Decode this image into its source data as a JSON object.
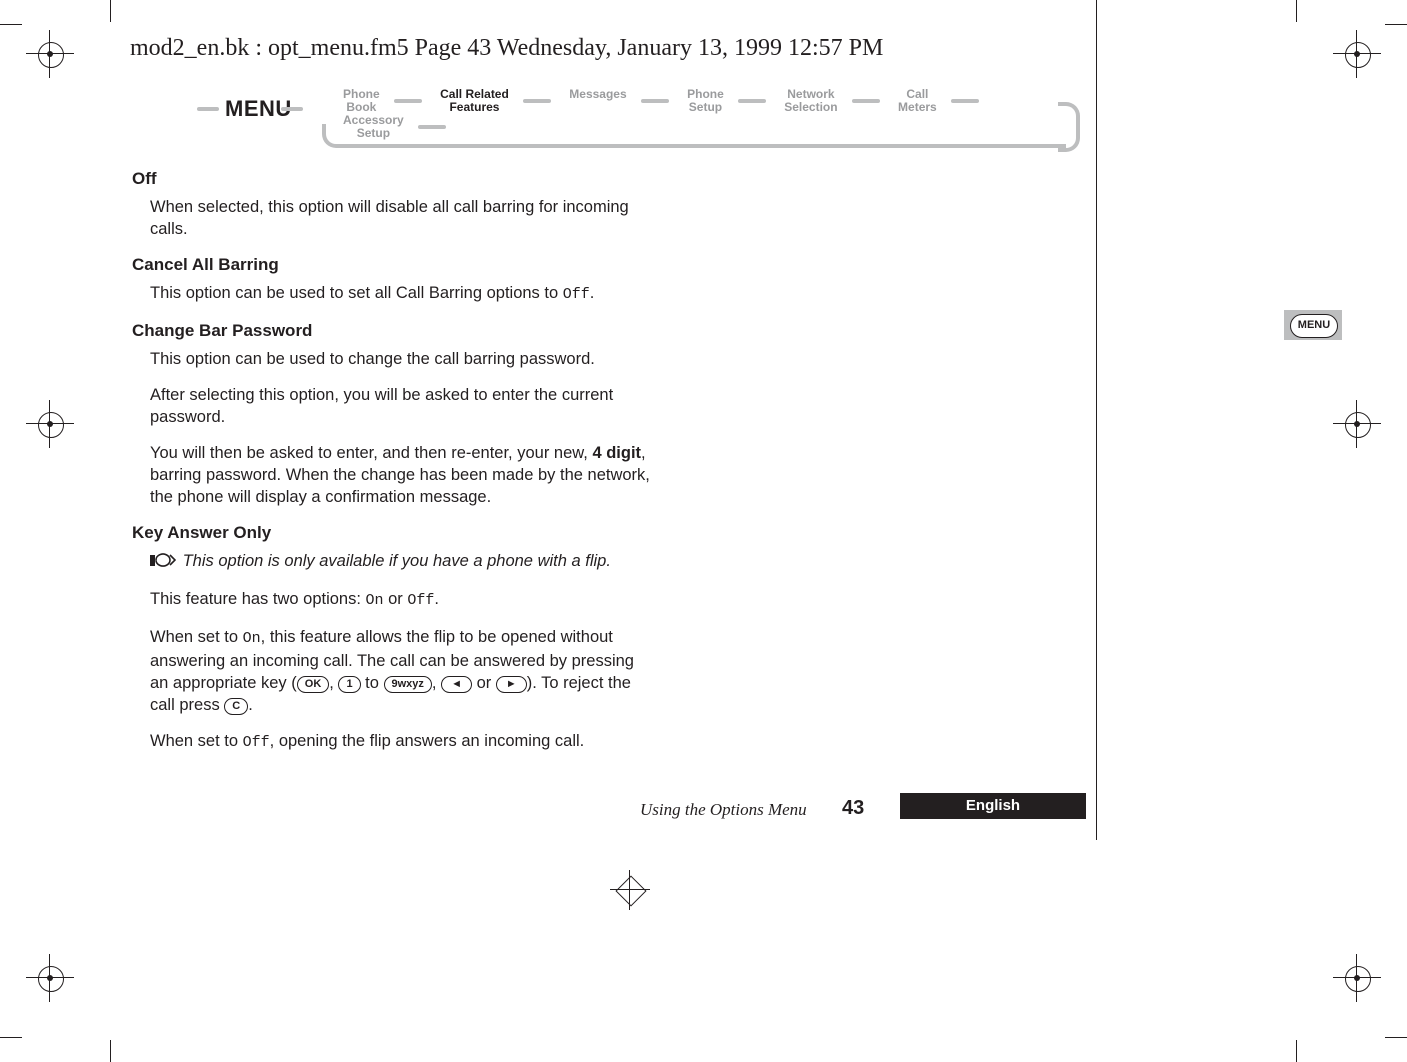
{
  "running_header": "mod2_en.bk : opt_menu.fm5  Page 43  Wednesday, January 13, 1999  12:57 PM",
  "menu": {
    "label": "MENU",
    "crumbs": [
      {
        "l1": "Phone",
        "l2": "Book",
        "active": false
      },
      {
        "l1": "Call Related",
        "l2": "Features",
        "active": true
      },
      {
        "l1": "Messages",
        "l2": "",
        "active": false
      },
      {
        "l1": "Phone",
        "l2": "Setup",
        "active": false
      },
      {
        "l1": "Network",
        "l2": "Selection",
        "active": false
      },
      {
        "l1": "Call",
        "l2": "Meters",
        "active": false
      },
      {
        "l1": "Accessory",
        "l2": "Setup",
        "active": false
      }
    ]
  },
  "side_tab": "MENU",
  "sections": {
    "off_h": "Off",
    "off_p": "When selected, this option will disable all call barring for incoming calls.",
    "cab_h": "Cancel All Barring",
    "cab_p_pre": "This option can be used to set all Call Barring options to ",
    "cab_p_code": "Off",
    "cab_p_post": ".",
    "cbp_h": "Change Bar Password",
    "cbp_p1": "This option can be used to change the call barring password.",
    "cbp_p2": "After selecting this option, you will be asked to enter the current password.",
    "cbp_p3a": "You will then be asked to enter, and then re-enter, your new, ",
    "cbp_p3b": "4 digit",
    "cbp_p3c": ", barring password. When the change has been made by the network, the phone will display a confirmation message.",
    "kao_h": "Key Answer Only",
    "kao_note": "This option is only available if you have a phone with a flip.",
    "kao_p1_pre": "This feature has two options: ",
    "kao_p1_on": "On",
    "kao_p1_mid": " or ",
    "kao_p1_off": "Off",
    "kao_p1_post": ".",
    "kao_p2_pre": "When set to ",
    "kao_p2_on": "On",
    "kao_p2_a": ", this feature allows the flip to be opened without answering an incoming call. The call can be answered by pressing an appropriate key (",
    "kao_key_ok": "OK",
    "kao_p2_b": ", ",
    "kao_key_1": "1",
    "kao_p2_c": " to ",
    "kao_key_9": "9wxyz",
    "kao_p2_d": ", ",
    "kao_key_l": "◄",
    "kao_p2_e": " or ",
    "kao_key_r": "►",
    "kao_p2_f": "). To reject the call press ",
    "kao_key_c": "C",
    "kao_p2_g": ".",
    "kao_p3_pre": "When set to ",
    "kao_p3_off": "Off",
    "kao_p3_post": ", opening the flip answers an incoming call."
  },
  "footer": {
    "title": "Using the Options Menu",
    "page": "43",
    "lang": "English"
  }
}
